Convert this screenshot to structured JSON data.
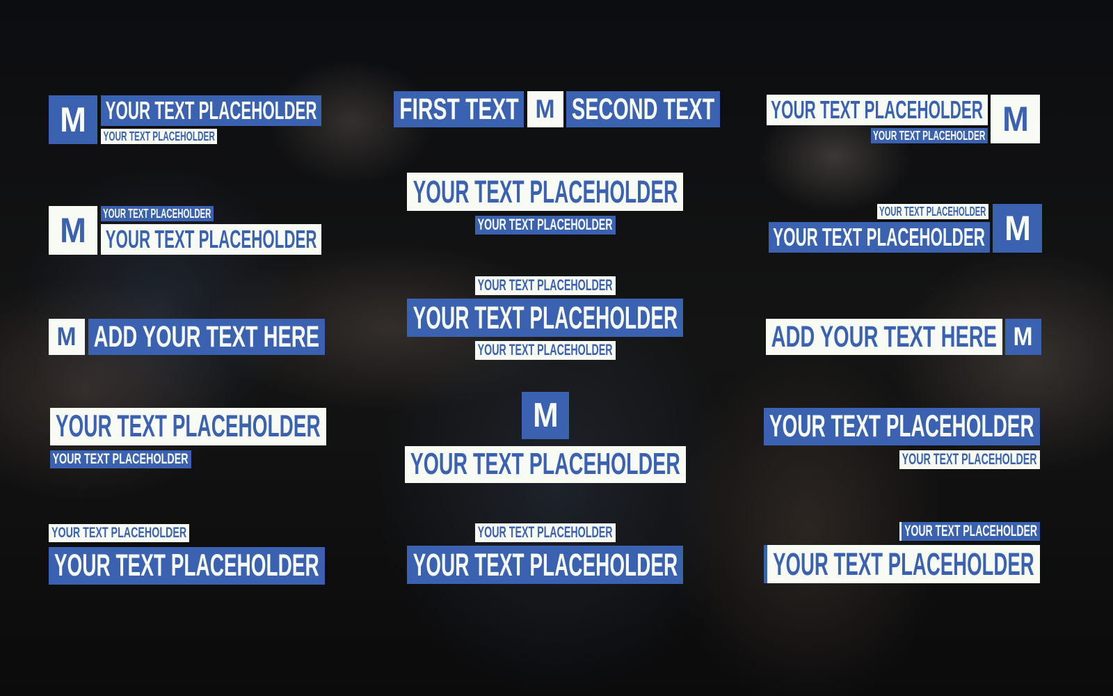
{
  "colors": {
    "blue": "#3a62b0",
    "white": "#f7fbf3"
  },
  "logo_letter": "M",
  "left": [
    {
      "main": "YOUR TEXT PLACEHOLDER",
      "sub": "YOUR TEXT PLACEHOLDER"
    },
    {
      "main": "YOUR TEXT PLACEHOLDER",
      "sub": "YOUR TEXT PLACEHOLDER"
    },
    {
      "main": "ADD YOUR TEXT HERE"
    },
    {
      "main": "YOUR TEXT PLACEHOLDER",
      "sub": "YOUR TEXT PLACEHOLDER"
    },
    {
      "main": "YOUR TEXT PLACEHOLDER",
      "sub": "YOUR TEXT PLACEHOLDER"
    }
  ],
  "middle": [
    {
      "first": "FIRST TEXT",
      "second": "SECOND TEXT"
    },
    {
      "main": "YOUR TEXT PLACEHOLDER",
      "sub": "YOUR TEXT PLACEHOLDER"
    },
    {
      "main": "YOUR TEXT PLACEHOLDER",
      "sub_top": "YOUR TEXT PLACEHOLDER",
      "sub_bottom": "YOUR TEXT PLACEHOLDER"
    },
    {
      "main": "YOUR TEXT PLACEHOLDER"
    },
    {
      "main": "YOUR TEXT PLACEHOLDER",
      "sub": "YOUR TEXT PLACEHOLDER"
    }
  ],
  "right": [
    {
      "main": "YOUR TEXT PLACEHOLDER",
      "sub": "YOUR TEXT PLACEHOLDER"
    },
    {
      "main": "YOUR TEXT PLACEHOLDER",
      "sub": "YOUR TEXT PLACEHOLDER"
    },
    {
      "main": "ADD YOUR TEXT HERE"
    },
    {
      "main": "YOUR TEXT PLACEHOLDER",
      "sub": "YOUR TEXT PLACEHOLDER"
    },
    {
      "main": "YOUR TEXT PLACEHOLDER",
      "sub": "YOUR TEXT PLACEHOLDER"
    }
  ]
}
